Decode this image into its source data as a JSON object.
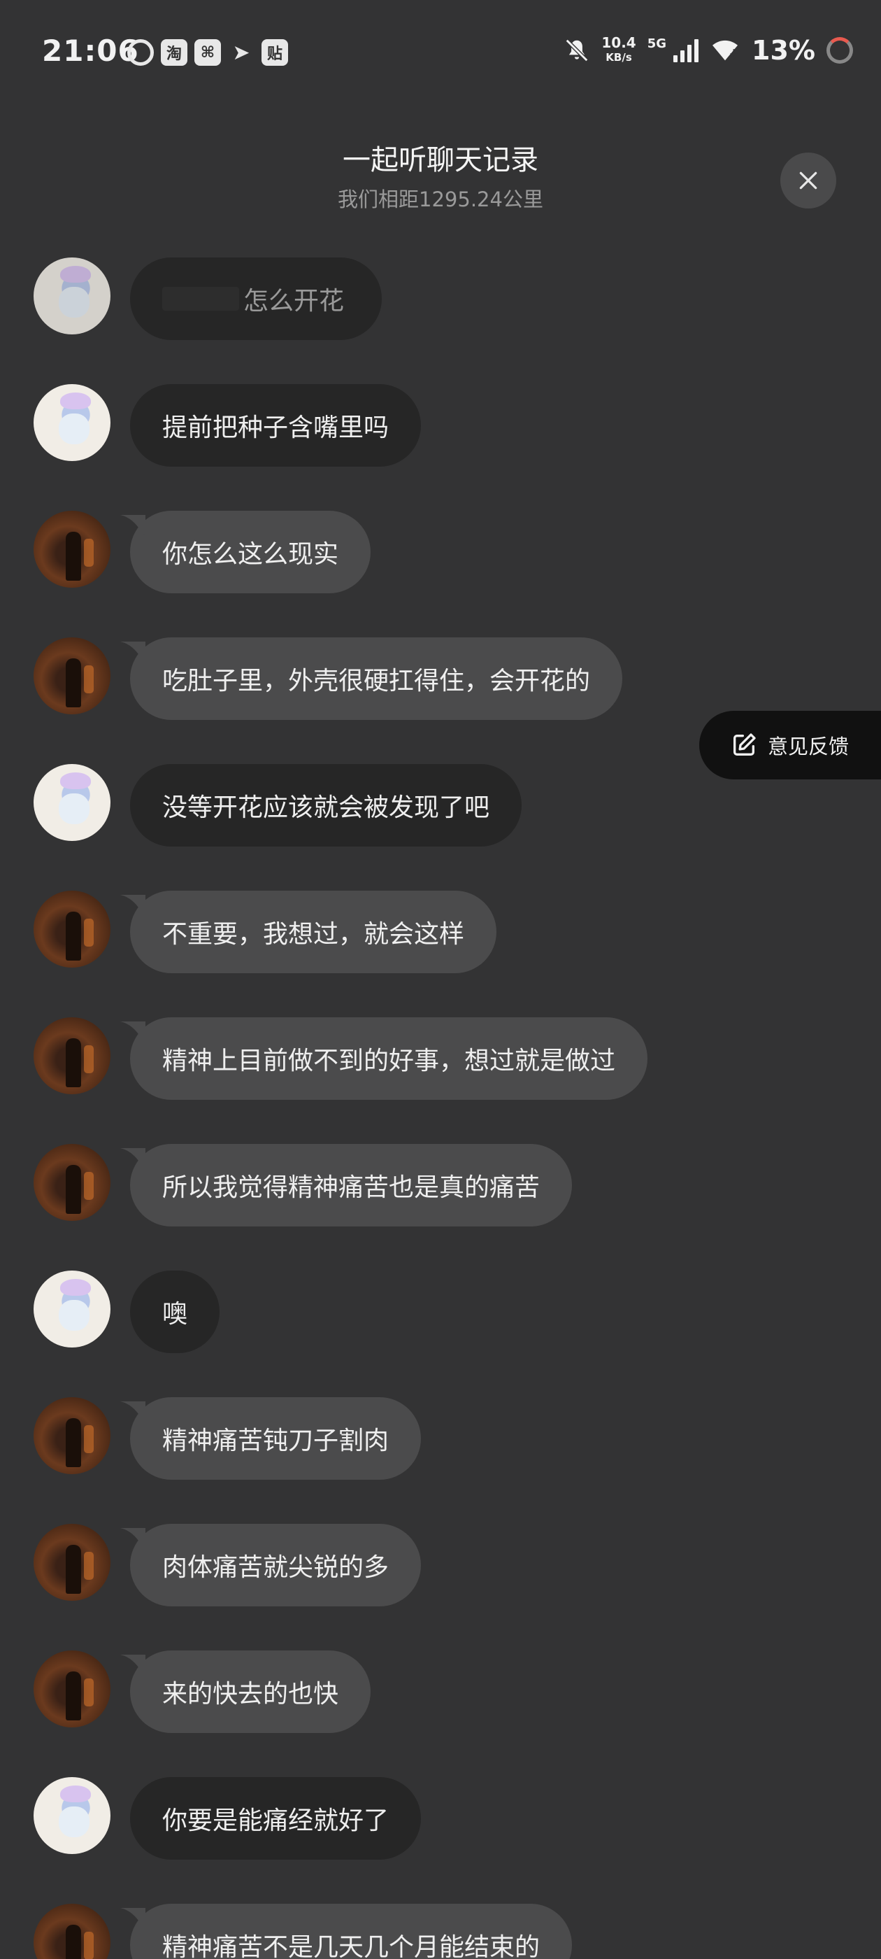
{
  "status_bar": {
    "time": "21:06",
    "apps": [
      "◎",
      "淘",
      "⌘",
      "➤",
      "贴"
    ],
    "net_speed_value": "10.4",
    "net_speed_unit": "KB/s",
    "signal": "5G",
    "battery": "13%"
  },
  "header": {
    "title": "一起听聊天记录",
    "subtitle": "我们相距1295.24公里"
  },
  "feedback": {
    "label": "意见反馈"
  },
  "colors": {
    "background": "#333334",
    "bubble_light": "#4b4b4c",
    "bubble_dark": "#262626",
    "feedback_bg": "#111111"
  },
  "messages": [
    {
      "sender": "girl",
      "text": "怎么开花",
      "partially_hidden": true
    },
    {
      "sender": "girl",
      "text": "提前把种子含嘴里吗"
    },
    {
      "sender": "dark",
      "text": "你怎么这么现实"
    },
    {
      "sender": "dark",
      "text": "吃肚子里，外壳很硬扛得住，会开花的"
    },
    {
      "sender": "girl",
      "text": "没等开花应该就会被发现了吧"
    },
    {
      "sender": "dark",
      "text": "不重要，我想过，就会这样"
    },
    {
      "sender": "dark",
      "text": "精神上目前做不到的好事，想过就是做过"
    },
    {
      "sender": "dark",
      "text": "所以我觉得精神痛苦也是真的痛苦"
    },
    {
      "sender": "girl",
      "text": "噢"
    },
    {
      "sender": "dark",
      "text": "精神痛苦钝刀子割肉"
    },
    {
      "sender": "dark",
      "text": "肉体痛苦就尖锐的多"
    },
    {
      "sender": "dark",
      "text": "来的快去的也快"
    },
    {
      "sender": "girl",
      "text": "你要是能痛经就好了"
    },
    {
      "sender": "dark",
      "text": "精神痛苦不是几天几个月能结束的"
    }
  ]
}
